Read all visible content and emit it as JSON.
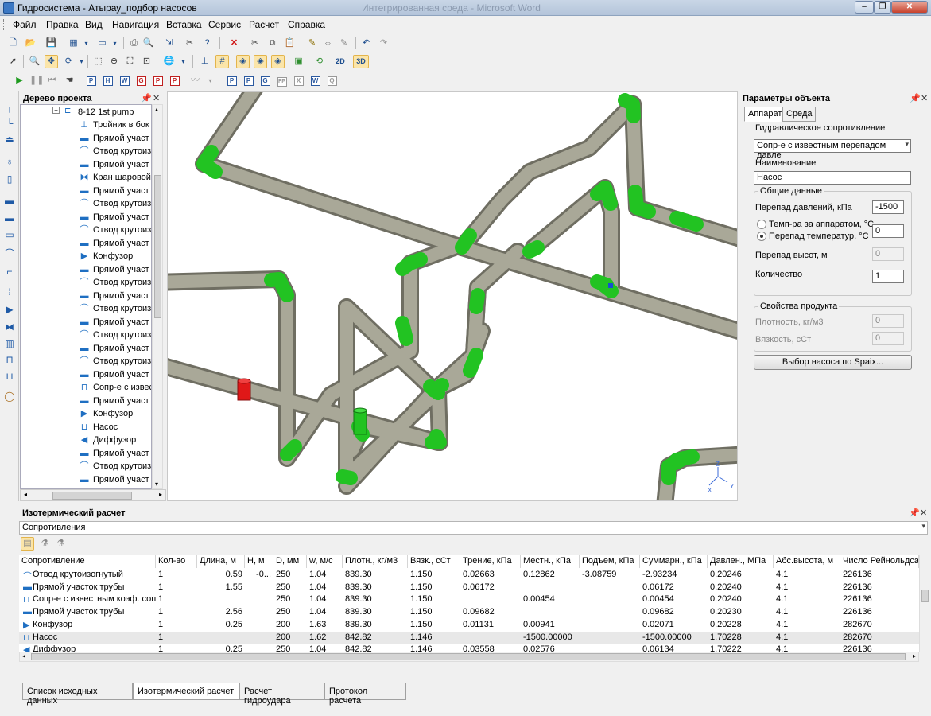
{
  "window": {
    "title": "Гидросистема - Атырау_подбор насосов",
    "ghost_title": "Интегрированная среда - Microsoft Word"
  },
  "menu": [
    "Файл",
    "Правка",
    "Вид",
    "Навигация",
    "Вставка",
    "Сервис",
    "Расчет",
    "Справка"
  ],
  "toolbar2": {
    "btn_2d": "2D",
    "btn_3d": "3D"
  },
  "toolbar3": {
    "letters": [
      "P",
      "H",
      "W",
      "G",
      "P",
      "P",
      "P",
      "P",
      "G",
      "FP",
      "X",
      "W",
      "Q"
    ]
  },
  "tree": {
    "title": "Дерево проекта",
    "root": "8-12 1st pump",
    "items": [
      {
        "icon": "tee-icon",
        "label": "Тройник в бок"
      },
      {
        "icon": "pipe-icon",
        "label": "Прямой участ"
      },
      {
        "icon": "bend-icon",
        "label": "Отвод крутоиз"
      },
      {
        "icon": "pipe-icon",
        "label": "Прямой участ"
      },
      {
        "icon": "valve-icon",
        "label": "Кран шаровой"
      },
      {
        "icon": "pipe-icon",
        "label": "Прямой участ"
      },
      {
        "icon": "bend-icon",
        "label": "Отвод крутоиз"
      },
      {
        "icon": "pipe-icon",
        "label": "Прямой участ"
      },
      {
        "icon": "bend-icon",
        "label": "Отвод крутоиз"
      },
      {
        "icon": "pipe-icon",
        "label": "Прямой участ"
      },
      {
        "icon": "confuser-icon",
        "label": "Конфузор"
      },
      {
        "icon": "pipe-icon",
        "label": "Прямой участ"
      },
      {
        "icon": "bend-icon",
        "label": "Отвод крутоиз"
      },
      {
        "icon": "pipe-icon",
        "label": "Прямой участ"
      },
      {
        "icon": "bend-icon",
        "label": "Отвод крутоиз"
      },
      {
        "icon": "pipe-icon",
        "label": "Прямой участ"
      },
      {
        "icon": "bend-icon",
        "label": "Отвод крутоиз"
      },
      {
        "icon": "pipe-icon",
        "label": "Прямой участ"
      },
      {
        "icon": "bend-icon",
        "label": "Отвод крутоиз"
      },
      {
        "icon": "pipe-icon",
        "label": "Прямой участ"
      },
      {
        "icon": "resistance-icon",
        "label": "Сопр-е с извес"
      },
      {
        "icon": "pipe-icon",
        "label": "Прямой участ"
      },
      {
        "icon": "confuser-icon",
        "label": "Конфузор"
      },
      {
        "icon": "pump-icon",
        "label": "Насос"
      },
      {
        "icon": "diffuser-icon",
        "label": "Диффузор"
      },
      {
        "icon": "pipe-icon",
        "label": "Прямой участ"
      },
      {
        "icon": "bend-icon",
        "label": "Отвод крутоиз"
      },
      {
        "icon": "pipe-icon",
        "label": "Прямой участ"
      }
    ]
  },
  "axes": {
    "x": "X",
    "y": "Y",
    "z": "Z"
  },
  "props": {
    "title": "Параметры объекта",
    "tabs": [
      "Аппарат",
      "Среда"
    ],
    "hydraulic_label": "Гидравлическое сопротивление",
    "hydraulic_value": "Сопр-е с известным перепадом давле",
    "name_label": "Наименование",
    "name_value": "Насос",
    "general_title": "Общие данные",
    "pressure_label": "Перепад давлений, кПа",
    "pressure_value": "-1500",
    "temp_label": "Темп-ра за аппаратом, °С",
    "tempdiff_label": "Перепад температур, °С",
    "tempdiff_value": "0",
    "height_label": "Перепад высот, м",
    "height_value": "0",
    "qty_label": "Количество",
    "qty_value": "1",
    "product_title": "Свойства продукта",
    "density_label": "Плотность, кг/м3",
    "density_value": "0",
    "viscosity_label": "Вязкость, сСт",
    "viscosity_value": "0",
    "select_pump_button": "Выбор насоса по Spaix..."
  },
  "calc": {
    "title": "Изотермический расчет",
    "combo_value": "Сопротивления",
    "columns": [
      "Сопротивление",
      "Кол-во",
      "Длина, м",
      "Н, м",
      "D, мм",
      "w, м/с",
      "Плотн., кг/м3",
      "Вязк., сСт",
      "Трение, кПа",
      "Местн., кПа",
      "Подъем, кПа",
      "Суммарн., кПа",
      "Давлен., МПа",
      "Абс.высота, м",
      "Число Рейнольдса"
    ],
    "rows": [
      {
        "icon": "bend-icon",
        "cells": [
          "Отвод крутоизогнутый",
          "1",
          "0.59",
          "-0...",
          "250",
          "1.04",
          "839.30",
          "1.150",
          "0.02663",
          "0.12862",
          "-3.08759",
          "-2.93234",
          "0.20246",
          "4.1",
          "226136"
        ]
      },
      {
        "icon": "pipe-icon",
        "cells": [
          "Прямой участок трубы",
          "1",
          "1.55",
          "",
          "250",
          "1.04",
          "839.30",
          "1.150",
          "0.06172",
          "",
          "",
          "0.06172",
          "0.20240",
          "4.1",
          "226136"
        ]
      },
      {
        "icon": "resistance-icon",
        "cells": [
          "Сопр-е с известным коэф. соп...",
          "1",
          "",
          "",
          "250",
          "1.04",
          "839.30",
          "1.150",
          "",
          "0.00454",
          "",
          "0.00454",
          "0.20240",
          "4.1",
          "226136"
        ]
      },
      {
        "icon": "pipe-icon",
        "cells": [
          "Прямой участок трубы",
          "1",
          "2.56",
          "",
          "250",
          "1.04",
          "839.30",
          "1.150",
          "0.09682",
          "",
          "",
          "0.09682",
          "0.20230",
          "4.1",
          "226136"
        ]
      },
      {
        "icon": "confuser-icon",
        "cells": [
          "Конфузор",
          "1",
          "0.25",
          "",
          "200",
          "1.63",
          "839.30",
          "1.150",
          "0.01131",
          "0.00941",
          "",
          "0.02071",
          "0.20228",
          "4.1",
          "282670"
        ]
      },
      {
        "icon": "pump-icon",
        "cells": [
          "Насос",
          "1",
          "",
          "",
          "200",
          "1.62",
          "842.82",
          "1.146",
          "",
          "-1500.00000",
          "",
          "-1500.00000",
          "1.70228",
          "4.1",
          "282670"
        ]
      },
      {
        "icon": "diffuser-icon",
        "cells": [
          "Диффузор",
          "1",
          "0.25",
          "",
          "250",
          "1.04",
          "842.82",
          "1.146",
          "0.03558",
          "0.02576",
          "",
          "0.06134",
          "1.70222",
          "4.1",
          "226136"
        ]
      }
    ]
  },
  "bottom_tabs": [
    "Список исходных данных",
    "Изотермический расчет",
    "Расчет гидроудара",
    "Протокол расчета"
  ],
  "colors": {
    "pipe": "#a9a898",
    "pipe_stroke": "#6f6e62",
    "fitting": "#22c322",
    "pump": "#e01818",
    "selection": "#fbe5a9"
  }
}
